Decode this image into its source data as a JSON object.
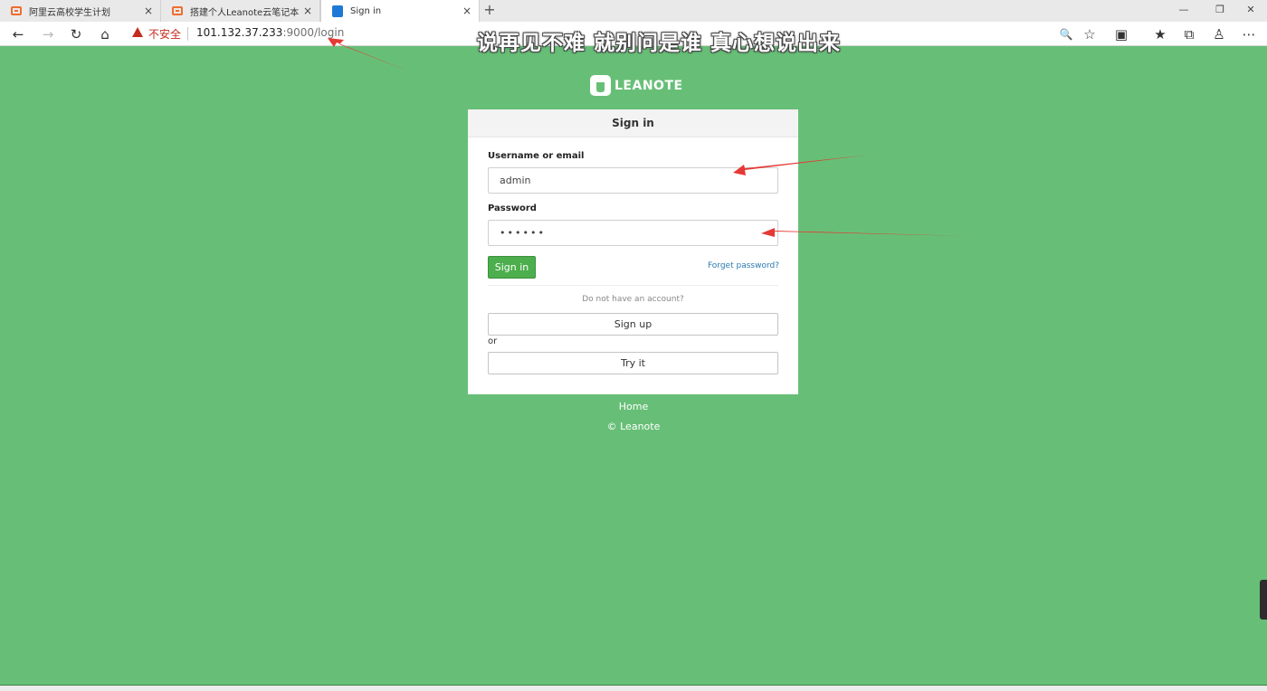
{
  "browser": {
    "tabs": [
      {
        "label": "阿里云高校学生计划",
        "close": "×"
      },
      {
        "label": "搭建个人Leanote云笔记本 - 开发",
        "close": "×"
      },
      {
        "label": "Sign in",
        "close": "×"
      }
    ],
    "new_tab": "+",
    "window_controls": {
      "minimize": "—",
      "restore": "❐",
      "close": "✕"
    },
    "nav": {
      "back": "←",
      "forward": "→",
      "reload": "↻",
      "home": "⌂"
    },
    "security_warning": "不安全",
    "url": {
      "host": "101.132.37.233",
      "path": ":9000/login"
    },
    "toolbar_icons": {
      "zoom": "🔍",
      "favorite": "☆",
      "extension": "▣",
      "favorites_bar": "★",
      "collections": "⧉",
      "profile": "♙",
      "menu": "⋯"
    }
  },
  "overlay_subtitle": "说再见不难 就别问是谁 真心想说出来",
  "logo": {
    "text": "LEANOTE"
  },
  "login": {
    "heading": "Sign in",
    "username_label": "Username or email",
    "username_value": "admin",
    "password_label": "Password",
    "password_value": "••••••",
    "signin_button": "Sign in",
    "forget_password": "Forget password?",
    "no_account": "Do not have an account?",
    "signup_button": "Sign up",
    "or_text": "or",
    "try_button": "Try it"
  },
  "footer": {
    "home": "Home",
    "copyright": "© Leanote"
  },
  "colors": {
    "page_bg": "#67bf77",
    "primary_button": "#4cae4c",
    "link": "#2a7ab0",
    "warning": "#c42b1c",
    "annotation_arrow": "#e53935"
  }
}
